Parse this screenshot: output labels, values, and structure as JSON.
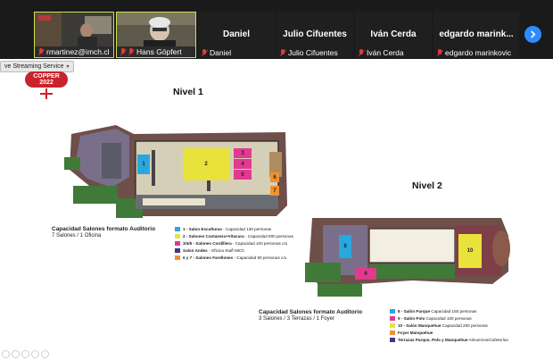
{
  "participants": {
    "video_tiles": [
      {
        "name": "rmartinez@imch.cl",
        "muted": true
      },
      {
        "name": "Hans Göpfert",
        "muted": true
      }
    ],
    "name_tiles": [
      {
        "display": "Daniel",
        "label": "Daniel"
      },
      {
        "display": "Julio Cifuentes",
        "label": "Julio Cifuentes"
      },
      {
        "display": "Iván Cerda",
        "label": "Iván Cerda"
      },
      {
        "display": "edgardo  marink...",
        "label": "edgardo marinkovic"
      }
    ],
    "next_icon": "chevron-right-icon"
  },
  "share_control": {
    "label": "ve Streaming Service",
    "caret": "▾"
  },
  "slide": {
    "logo": {
      "line1": "COPPER",
      "line2": "2022"
    },
    "level1": {
      "title": "Nivel 1",
      "rooms": [
        "1",
        "2",
        "3",
        "4",
        "5",
        "6",
        "7"
      ],
      "capacity_title": "Capacidad Salones formato Auditorio",
      "capacity_sub": "7 Salones / 1 Oficina",
      "legend": [
        {
          "color": "#29a8e0",
          "bold": "1 - Salon Esculturas",
          "rest": " - Capacidad 130 personas"
        },
        {
          "color": "#e8e23a",
          "bold": "2 - Salones Costanera+Vitacura",
          "rest": " - Capacidad 800 personas"
        },
        {
          "color": "#e0398f",
          "bold": "3/4/5 - Salones Cordillera",
          "rest": " - Capacidad 100 personas c/u"
        },
        {
          "color": "#3a3a8c",
          "bold": "Salon Andes",
          "rest": " - Oficina Staff MICh"
        },
        {
          "color": "#f0922e",
          "bold": "6 y 7 - Salones Farellones",
          "rest": " - Capacidad 80 personas c/u"
        }
      ]
    },
    "level2": {
      "title": "Nivel 2",
      "rooms": [
        "8",
        "9",
        "10"
      ],
      "capacity_title": "Capacidad Salones formato Auditorio",
      "capacity_sub": "3 Salones / 3 Terrazas / 1 Foyer",
      "legend": [
        {
          "color": "#29a8e0",
          "bold": "8 - Salón Parque",
          "rest": " Capacidad 150 personas"
        },
        {
          "color": "#e0398f",
          "bold": "9 - Salón Polo",
          "rest": " Capacidad 100 personas"
        },
        {
          "color": "#e8e23a",
          "bold": "10 - Salón Manquehue",
          "rest": " Capacidad 200 personas"
        },
        {
          "color": "#f0922e",
          "bold": "Foyer Manquehue",
          "rest": ""
        },
        {
          "color": "#3a3a8c",
          "bold": "Terrazas Parque, Polo y Manquehue",
          "rest": " Almuerzos/Cafeterías"
        }
      ]
    }
  }
}
